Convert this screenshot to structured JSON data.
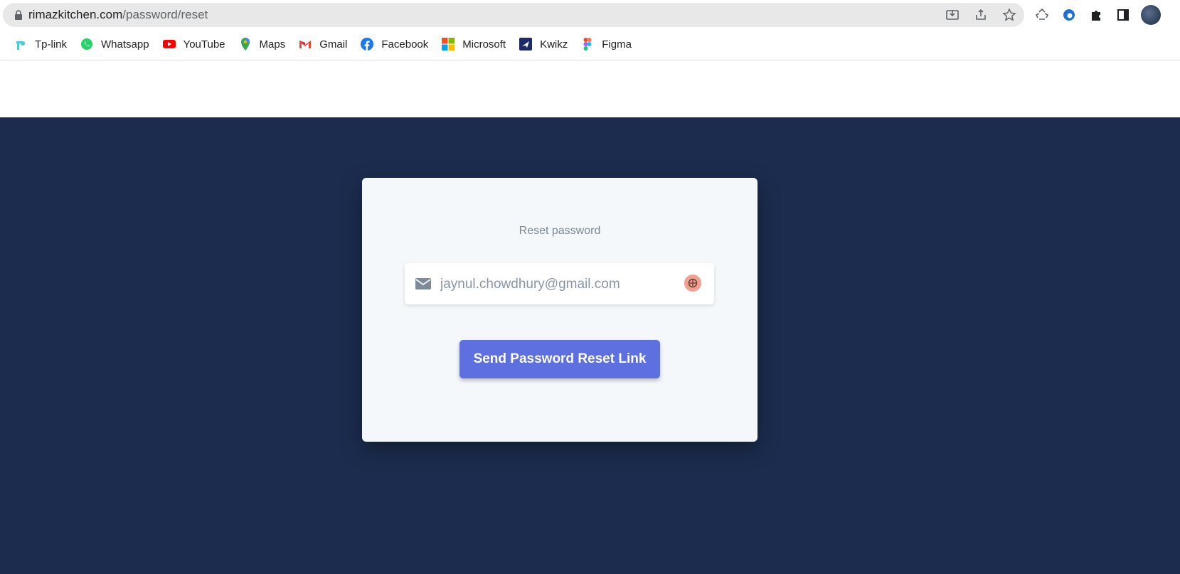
{
  "browser": {
    "url_host": "rimazkitchen.com",
    "url_path": "/password/reset",
    "bookmarks": [
      {
        "label": "Tp-link",
        "icon": "tplink-icon"
      },
      {
        "label": "Whatsapp",
        "icon": "whatsapp-icon"
      },
      {
        "label": "YouTube",
        "icon": "youtube-icon"
      },
      {
        "label": "Maps",
        "icon": "maps-icon"
      },
      {
        "label": "Gmail",
        "icon": "gmail-icon"
      },
      {
        "label": "Facebook",
        "icon": "facebook-icon"
      },
      {
        "label": "Microsoft",
        "icon": "microsoft-icon"
      },
      {
        "label": "Kwikz",
        "icon": "kwikz-icon"
      },
      {
        "label": "Figma",
        "icon": "figma-icon"
      }
    ]
  },
  "reset_form": {
    "title": "Reset password",
    "email_value": "jaynul.chowdhury@gmail.com",
    "submit_label": "Send Password Reset Link"
  },
  "colors": {
    "page_background": "#1b2c4e",
    "card_background": "#f5f8fb",
    "button": "#5e6fe0"
  }
}
